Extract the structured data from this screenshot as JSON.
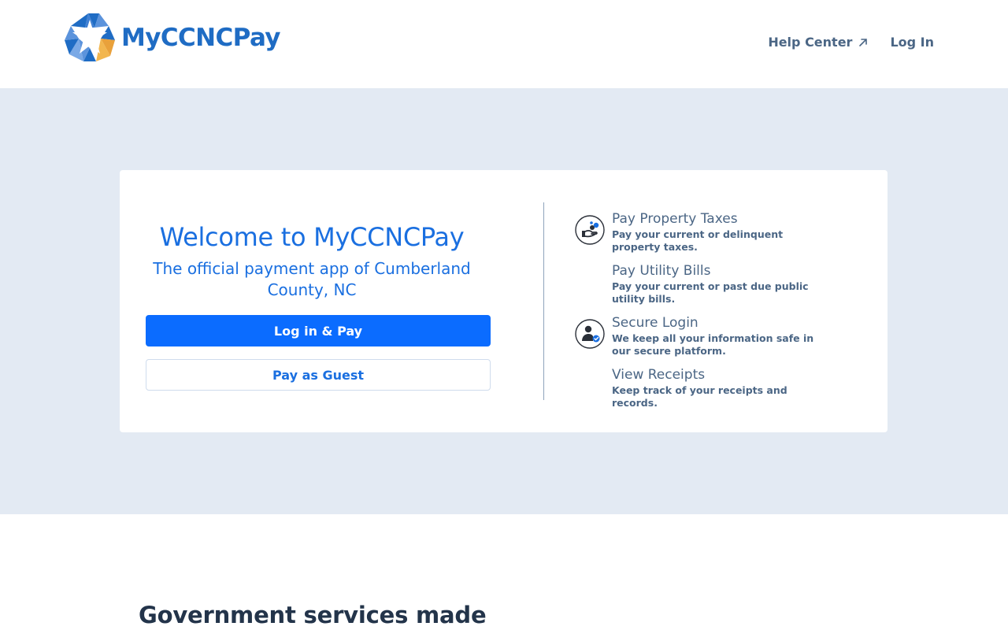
{
  "header": {
    "brand": "MyCCNCPay",
    "nav": {
      "help_center": "Help Center",
      "log_in": "Log In"
    }
  },
  "hero": {
    "title": "Welcome to MyCCNCPay",
    "subtitle": "The official payment app of Cumberland County, NC",
    "primary_button": "Log in & Pay",
    "secondary_button": "Pay as Guest"
  },
  "features": [
    {
      "title": "Pay Property Taxes",
      "desc": "Pay your current or delinquent property taxes.",
      "icon": "property-tax-icon"
    },
    {
      "title": "Pay Utility Bills",
      "desc": "Pay your current or past due public utility bills.",
      "icon": ""
    },
    {
      "title": "Secure Login",
      "desc": "We keep all your information safe in our secure platform.",
      "icon": "secure-login-icon"
    },
    {
      "title": "View Receipts",
      "desc": "Keep track of your receipts and records.",
      "icon": ""
    }
  ],
  "section": {
    "title": "Government services made"
  },
  "colors": {
    "brand_blue": "#1f6cc4",
    "accent_blue": "#0b6cff",
    "hero_background": "#e3eaf3",
    "logo_orange": "#e9a13b"
  }
}
